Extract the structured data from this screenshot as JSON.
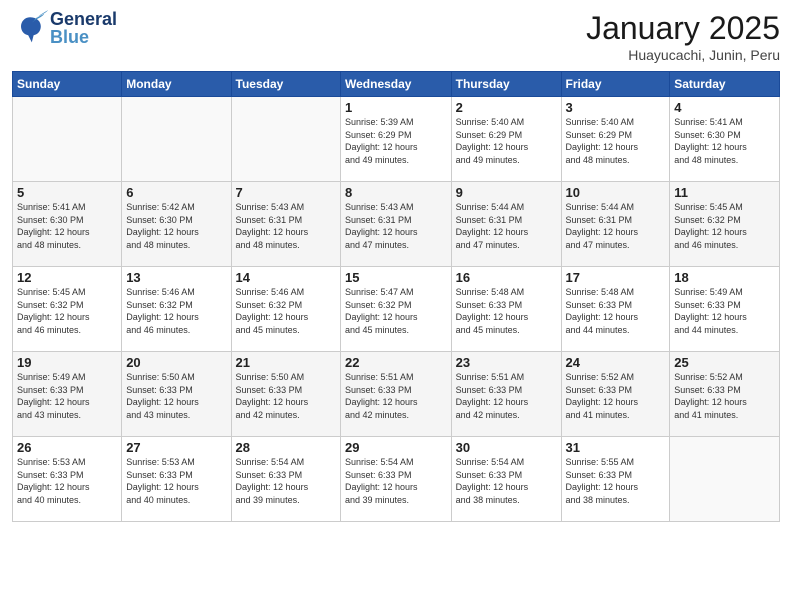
{
  "header": {
    "logo_general": "General",
    "logo_blue": "Blue",
    "month": "January 2025",
    "location": "Huayucachi, Junin, Peru"
  },
  "weekdays": [
    "Sunday",
    "Monday",
    "Tuesday",
    "Wednesday",
    "Thursday",
    "Friday",
    "Saturday"
  ],
  "weeks": [
    [
      {
        "day": "",
        "info": ""
      },
      {
        "day": "",
        "info": ""
      },
      {
        "day": "",
        "info": ""
      },
      {
        "day": "1",
        "info": "Sunrise: 5:39 AM\nSunset: 6:29 PM\nDaylight: 12 hours\nand 49 minutes."
      },
      {
        "day": "2",
        "info": "Sunrise: 5:40 AM\nSunset: 6:29 PM\nDaylight: 12 hours\nand 49 minutes."
      },
      {
        "day": "3",
        "info": "Sunrise: 5:40 AM\nSunset: 6:29 PM\nDaylight: 12 hours\nand 48 minutes."
      },
      {
        "day": "4",
        "info": "Sunrise: 5:41 AM\nSunset: 6:30 PM\nDaylight: 12 hours\nand 48 minutes."
      }
    ],
    [
      {
        "day": "5",
        "info": "Sunrise: 5:41 AM\nSunset: 6:30 PM\nDaylight: 12 hours\nand 48 minutes."
      },
      {
        "day": "6",
        "info": "Sunrise: 5:42 AM\nSunset: 6:30 PM\nDaylight: 12 hours\nand 48 minutes."
      },
      {
        "day": "7",
        "info": "Sunrise: 5:43 AM\nSunset: 6:31 PM\nDaylight: 12 hours\nand 48 minutes."
      },
      {
        "day": "8",
        "info": "Sunrise: 5:43 AM\nSunset: 6:31 PM\nDaylight: 12 hours\nand 47 minutes."
      },
      {
        "day": "9",
        "info": "Sunrise: 5:44 AM\nSunset: 6:31 PM\nDaylight: 12 hours\nand 47 minutes."
      },
      {
        "day": "10",
        "info": "Sunrise: 5:44 AM\nSunset: 6:31 PM\nDaylight: 12 hours\nand 47 minutes."
      },
      {
        "day": "11",
        "info": "Sunrise: 5:45 AM\nSunset: 6:32 PM\nDaylight: 12 hours\nand 46 minutes."
      }
    ],
    [
      {
        "day": "12",
        "info": "Sunrise: 5:45 AM\nSunset: 6:32 PM\nDaylight: 12 hours\nand 46 minutes."
      },
      {
        "day": "13",
        "info": "Sunrise: 5:46 AM\nSunset: 6:32 PM\nDaylight: 12 hours\nand 46 minutes."
      },
      {
        "day": "14",
        "info": "Sunrise: 5:46 AM\nSunset: 6:32 PM\nDaylight: 12 hours\nand 45 minutes."
      },
      {
        "day": "15",
        "info": "Sunrise: 5:47 AM\nSunset: 6:32 PM\nDaylight: 12 hours\nand 45 minutes."
      },
      {
        "day": "16",
        "info": "Sunrise: 5:48 AM\nSunset: 6:33 PM\nDaylight: 12 hours\nand 45 minutes."
      },
      {
        "day": "17",
        "info": "Sunrise: 5:48 AM\nSunset: 6:33 PM\nDaylight: 12 hours\nand 44 minutes."
      },
      {
        "day": "18",
        "info": "Sunrise: 5:49 AM\nSunset: 6:33 PM\nDaylight: 12 hours\nand 44 minutes."
      }
    ],
    [
      {
        "day": "19",
        "info": "Sunrise: 5:49 AM\nSunset: 6:33 PM\nDaylight: 12 hours\nand 43 minutes."
      },
      {
        "day": "20",
        "info": "Sunrise: 5:50 AM\nSunset: 6:33 PM\nDaylight: 12 hours\nand 43 minutes."
      },
      {
        "day": "21",
        "info": "Sunrise: 5:50 AM\nSunset: 6:33 PM\nDaylight: 12 hours\nand 42 minutes."
      },
      {
        "day": "22",
        "info": "Sunrise: 5:51 AM\nSunset: 6:33 PM\nDaylight: 12 hours\nand 42 minutes."
      },
      {
        "day": "23",
        "info": "Sunrise: 5:51 AM\nSunset: 6:33 PM\nDaylight: 12 hours\nand 42 minutes."
      },
      {
        "day": "24",
        "info": "Sunrise: 5:52 AM\nSunset: 6:33 PM\nDaylight: 12 hours\nand 41 minutes."
      },
      {
        "day": "25",
        "info": "Sunrise: 5:52 AM\nSunset: 6:33 PM\nDaylight: 12 hours\nand 41 minutes."
      }
    ],
    [
      {
        "day": "26",
        "info": "Sunrise: 5:53 AM\nSunset: 6:33 PM\nDaylight: 12 hours\nand 40 minutes."
      },
      {
        "day": "27",
        "info": "Sunrise: 5:53 AM\nSunset: 6:33 PM\nDaylight: 12 hours\nand 40 minutes."
      },
      {
        "day": "28",
        "info": "Sunrise: 5:54 AM\nSunset: 6:33 PM\nDaylight: 12 hours\nand 39 minutes."
      },
      {
        "day": "29",
        "info": "Sunrise: 5:54 AM\nSunset: 6:33 PM\nDaylight: 12 hours\nand 39 minutes."
      },
      {
        "day": "30",
        "info": "Sunrise: 5:54 AM\nSunset: 6:33 PM\nDaylight: 12 hours\nand 38 minutes."
      },
      {
        "day": "31",
        "info": "Sunrise: 5:55 AM\nSunset: 6:33 PM\nDaylight: 12 hours\nand 38 minutes."
      },
      {
        "day": "",
        "info": ""
      }
    ]
  ]
}
